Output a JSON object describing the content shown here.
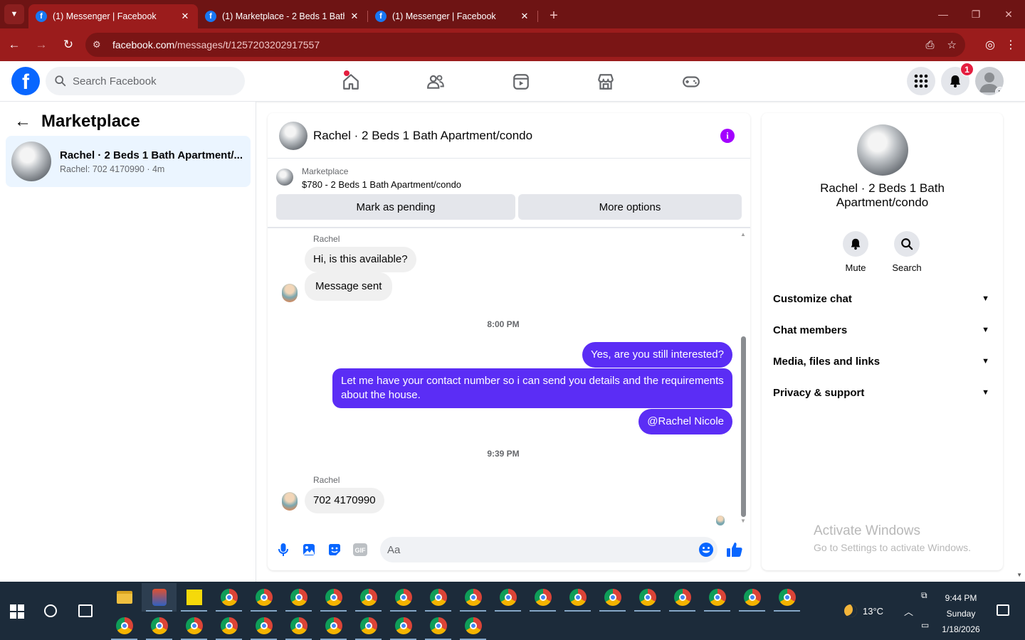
{
  "browser": {
    "tabs": [
      {
        "title": "(1) Messenger | Facebook",
        "active": true
      },
      {
        "title": "(1) Marketplace - 2 Beds 1 Bath",
        "active": false
      },
      {
        "title": "(1) Messenger | Facebook",
        "active": false
      }
    ],
    "url_host": "facebook.com",
    "url_path": "/messages/t/1257203202917557"
  },
  "header": {
    "search_placeholder": "Search Facebook",
    "notification_count": "1"
  },
  "sidebar": {
    "title": "Marketplace",
    "conversation": {
      "name": "Rachel · 2 Beds 1 Bath Apartment/...",
      "preview": "Rachel: 702 4170990 · 4m"
    }
  },
  "chat": {
    "title": "Rachel · 2 Beds 1 Bath Apartment/condo",
    "listing": {
      "source": "Marketplace",
      "summary": "$780 - 2 Beds 1 Bath Apartment/condo",
      "mark_pending_label": "Mark as pending",
      "more_options_label": "More options"
    },
    "messages": {
      "sender1": "Rachel",
      "m1": "Hi, is this available?",
      "m2": "Message sent",
      "time1": "8:00 PM",
      "m3": "Yes, are you still interested?",
      "m4": "Let me have your contact number so i can send you details and the requirements about the house.",
      "m5": "@Rachel Nicole",
      "time2": "9:39 PM",
      "sender2": "Rachel",
      "m6": "702 4170990"
    },
    "composer_placeholder": "Aa"
  },
  "info": {
    "name": "Rachel · 2 Beds 1 Bath Apartment/condo",
    "mute_label": "Mute",
    "search_label": "Search",
    "sections": [
      "Customize chat",
      "Chat members",
      "Media, files and links",
      "Privacy & support"
    ],
    "watermark_title": "Activate Windows",
    "watermark_sub": "Go to Settings to activate Windows."
  },
  "taskbar": {
    "temperature": "13°C",
    "time": "9:44 PM",
    "day": "Sunday",
    "date": "1/18/2026"
  },
  "colors": {
    "facebook_blue": "#0866ff",
    "outgoing_bubble": "#5b2df5",
    "browser_frame": "#9b1c1c",
    "notification_red": "#e41e3f"
  }
}
